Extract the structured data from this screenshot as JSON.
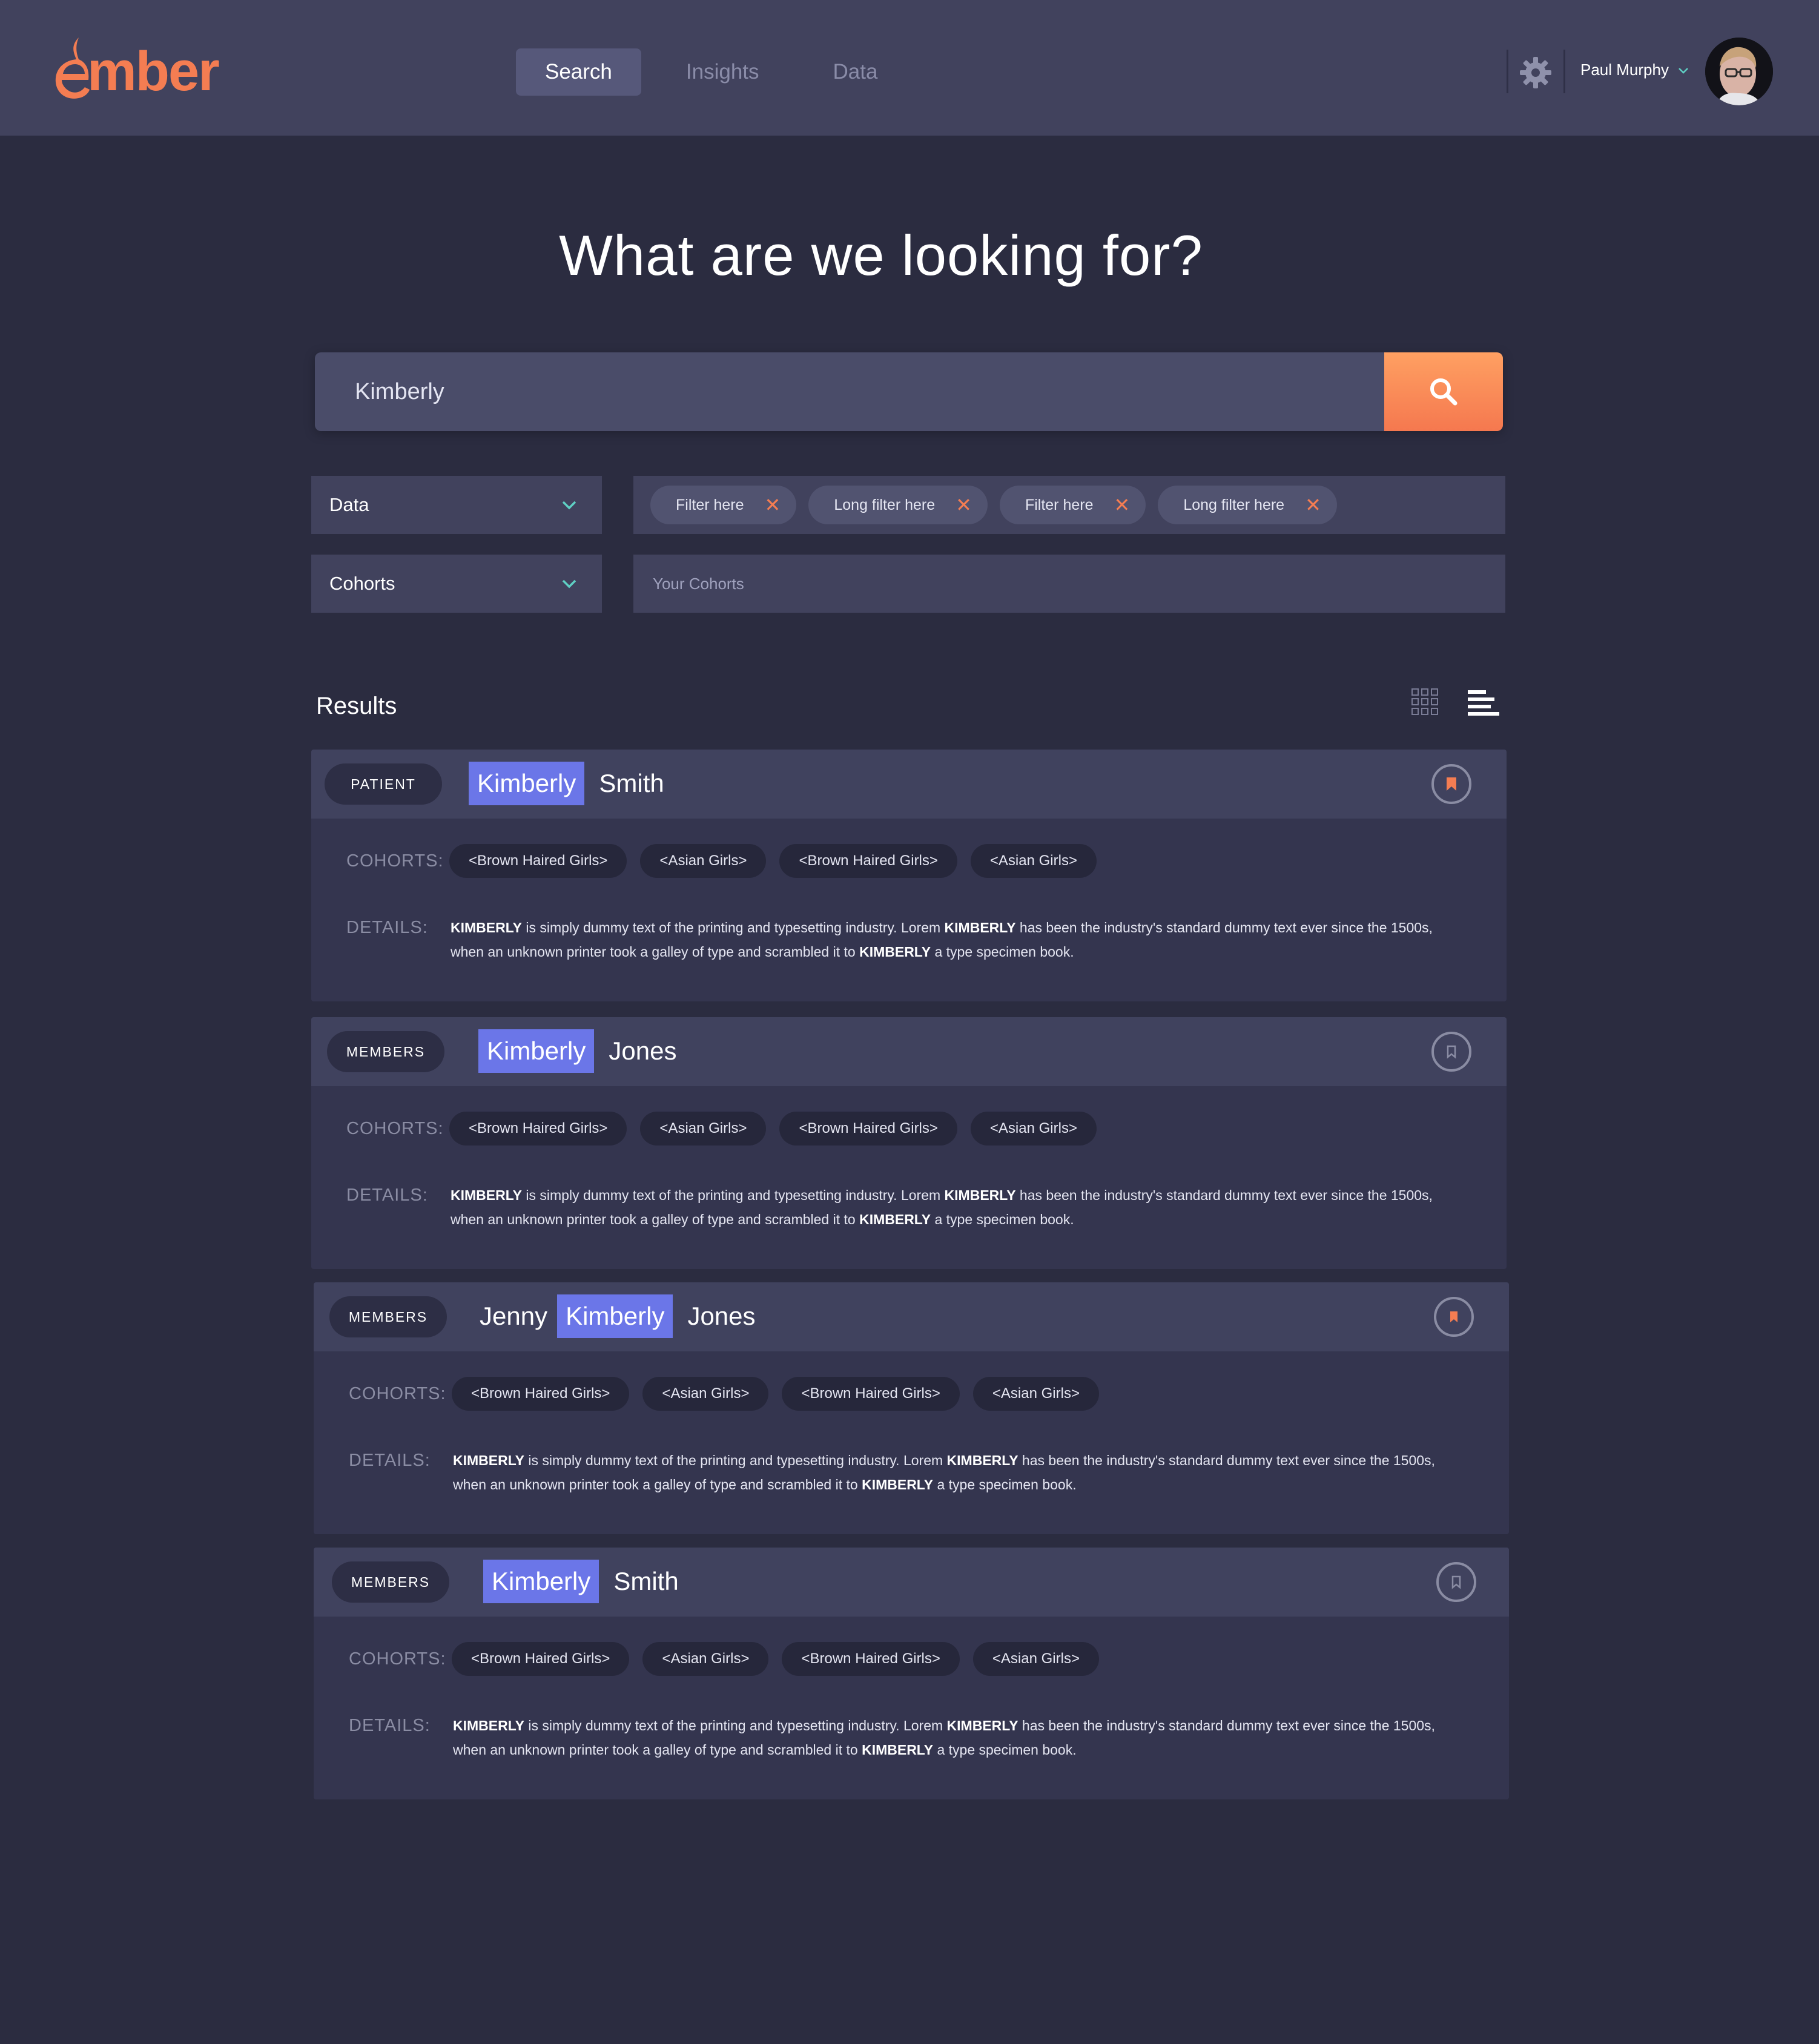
{
  "app": {
    "brand": "mber",
    "nav": [
      "Search",
      "Insights",
      "Data"
    ],
    "user_name": "Paul Murphy"
  },
  "hero": {
    "headline": "What are we looking for?",
    "search_value": "Kimberly"
  },
  "filters": {
    "data_dropdown": "Data",
    "cohorts_dropdown": "Cohorts",
    "chips": [
      "Filter here",
      "Long filter here",
      "Filter here",
      "Long filter here"
    ],
    "chip_remove": "✕",
    "cohorts_placeholder": "Your Cohorts"
  },
  "results": {
    "title": "Results",
    "cohorts_label": "COHORTS:",
    "details_label": "DETAILS:",
    "details": {
      "keyword": "KIMBERLY",
      "part1": " is simply dummy text of the printing and typesetting industry. Lorem ",
      "part2": " has been the industry's standard dummy text ever since the 1500s, when an unknown printer took a galley of type and scrambled it to ",
      "part3": " a type specimen book."
    },
    "items": [
      {
        "type": "PATIENT",
        "name_before": "",
        "name_highlight": "Kimberly",
        "name_after": "Smith",
        "bookmarked": true,
        "cohorts": [
          "<Brown Haired Girls>",
          "<Asian Girls>",
          "<Brown Haired Girls>",
          "<Asian Girls>"
        ]
      },
      {
        "type": "MEMBERS",
        "name_before": "",
        "name_highlight": "Kimberly",
        "name_after": "Jones",
        "bookmarked": false,
        "cohorts": [
          "<Brown Haired Girls>",
          "<Asian Girls>",
          "<Brown Haired Girls>",
          "<Asian Girls>"
        ]
      },
      {
        "type": "MEMBERS",
        "name_before": "Jenny",
        "name_highlight": "Kimberly",
        "name_after": "Jones",
        "bookmarked": true,
        "cohorts": [
          "<Brown Haired Girls>",
          "<Asian Girls>",
          "<Brown Haired Girls>",
          "<Asian Girls>"
        ]
      },
      {
        "type": "MEMBERS",
        "name_before": "",
        "name_highlight": "Kimberly",
        "name_after": "Smith",
        "bookmarked": false,
        "cohorts": [
          "<Brown Haired Girls>",
          "<Asian Girls>",
          "<Brown Haired Girls>",
          "<Asian Girls>"
        ]
      }
    ]
  },
  "colors": {
    "background": "#2b2c40",
    "header": "#41425d",
    "accent_orange": "#f47d52",
    "highlight_blue": "#6b76e8"
  }
}
